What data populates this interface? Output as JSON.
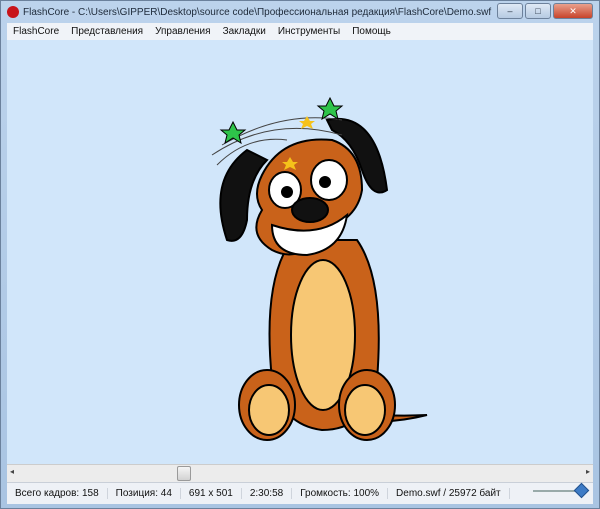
{
  "window": {
    "title": "FlashCore - C:\\Users\\GIPPER\\Desktop\\source code\\Профессиональная редакция\\FlashCore\\Demo.swf",
    "minimize": "–",
    "maximize": "□",
    "close": "✕"
  },
  "menu": [
    "FlashCore",
    "Представления",
    "Управления",
    "Закладки",
    "Инструменты",
    "Помощь"
  ],
  "scroll": {
    "left": "◂",
    "right": "▸"
  },
  "status": {
    "frames": "Всего кадров: 158",
    "position": "Позиция: 44",
    "size": "691 x 501",
    "time": "2:30:58",
    "volume": "Громкость: 100%",
    "file": "Demo.swf / 25972 байт"
  },
  "volume_level": 1.0,
  "colors": {
    "stage": "#d1e6fa",
    "dog": "#c9621a",
    "belly": "#f7c774"
  }
}
